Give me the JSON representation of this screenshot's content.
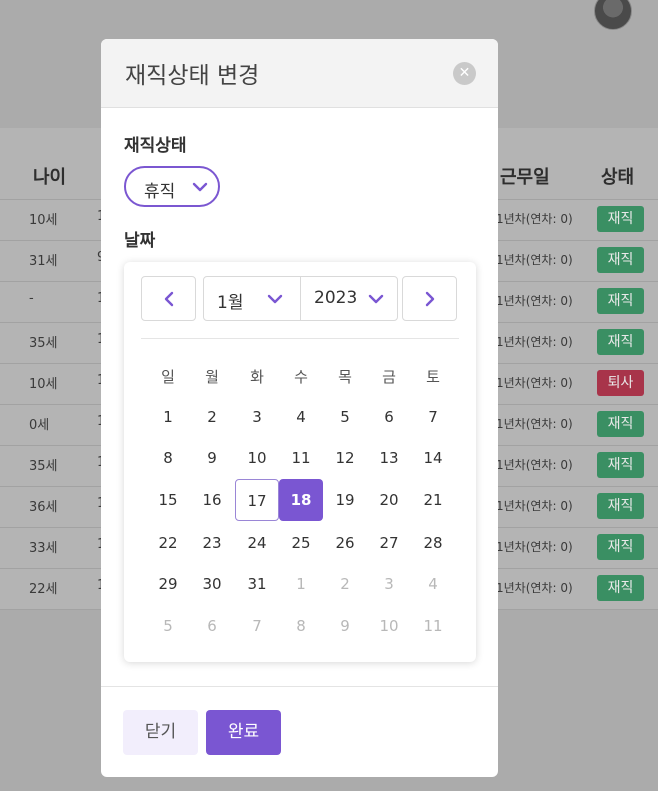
{
  "background": {
    "headers": {
      "age": "나이",
      "work_days": "근무일",
      "status": "상태"
    },
    "rows": [
      {
        "age": "10세",
        "peek": "1",
        "work": "1년차(연차: 0)",
        "status": "재직",
        "color": "green"
      },
      {
        "age": "31세",
        "peek": "9",
        "work": "1년차(연차: 0)",
        "status": "재직",
        "color": "green"
      },
      {
        "age": "-",
        "peek": "1",
        "work": "1년차(연차: 0)",
        "status": "재직",
        "color": "green"
      },
      {
        "age": "35세",
        "peek": "1",
        "work": "1년차(연차: 0)",
        "status": "재직",
        "color": "green"
      },
      {
        "age": "10세",
        "peek": "1",
        "work": "1년차(연차: 0)",
        "status": "퇴사",
        "color": "red"
      },
      {
        "age": "0세",
        "peek": "1",
        "work": "1년차(연차: 0)",
        "status": "재직",
        "color": "green"
      },
      {
        "age": "35세",
        "peek": "1",
        "work": "1년차(연차: 0)",
        "status": "재직",
        "color": "green"
      },
      {
        "age": "36세",
        "peek": "1",
        "work": "1년차(연차: 0)",
        "status": "재직",
        "color": "green"
      },
      {
        "age": "33세",
        "peek": "1",
        "work": "1년차(연차: 0)",
        "status": "재직",
        "color": "green"
      },
      {
        "age": "22세",
        "peek": "1",
        "work": "1년차(연차: 0)",
        "status": "재직",
        "color": "green"
      }
    ]
  },
  "modal": {
    "title": "재직상태 변경",
    "close_icon": "close-icon",
    "status_label": "재직상태",
    "status_value": "휴직",
    "date_label": "날짜",
    "calendar": {
      "month": "1월",
      "year": "2023",
      "weekdays": [
        "일",
        "월",
        "화",
        "수",
        "목",
        "금",
        "토"
      ],
      "weeks": [
        [
          "1",
          "2",
          "3",
          "4",
          "5",
          "6",
          "7"
        ],
        [
          "8",
          "9",
          "10",
          "11",
          "12",
          "13",
          "14"
        ],
        [
          "15",
          "16",
          "17",
          "18",
          "19",
          "20",
          "21"
        ],
        [
          "22",
          "23",
          "24",
          "25",
          "26",
          "27",
          "28"
        ],
        [
          "29",
          "30",
          "31",
          "1",
          "2",
          "3",
          "4"
        ],
        [
          "5",
          "6",
          "7",
          "8",
          "9",
          "10",
          "11"
        ]
      ],
      "today": "17",
      "selected": "18"
    },
    "buttons": {
      "close": "닫기",
      "done": "완료"
    }
  },
  "colors": {
    "accent": "#7a56d2",
    "green_badge": "#3a8f63",
    "red_badge": "#a8344a"
  }
}
